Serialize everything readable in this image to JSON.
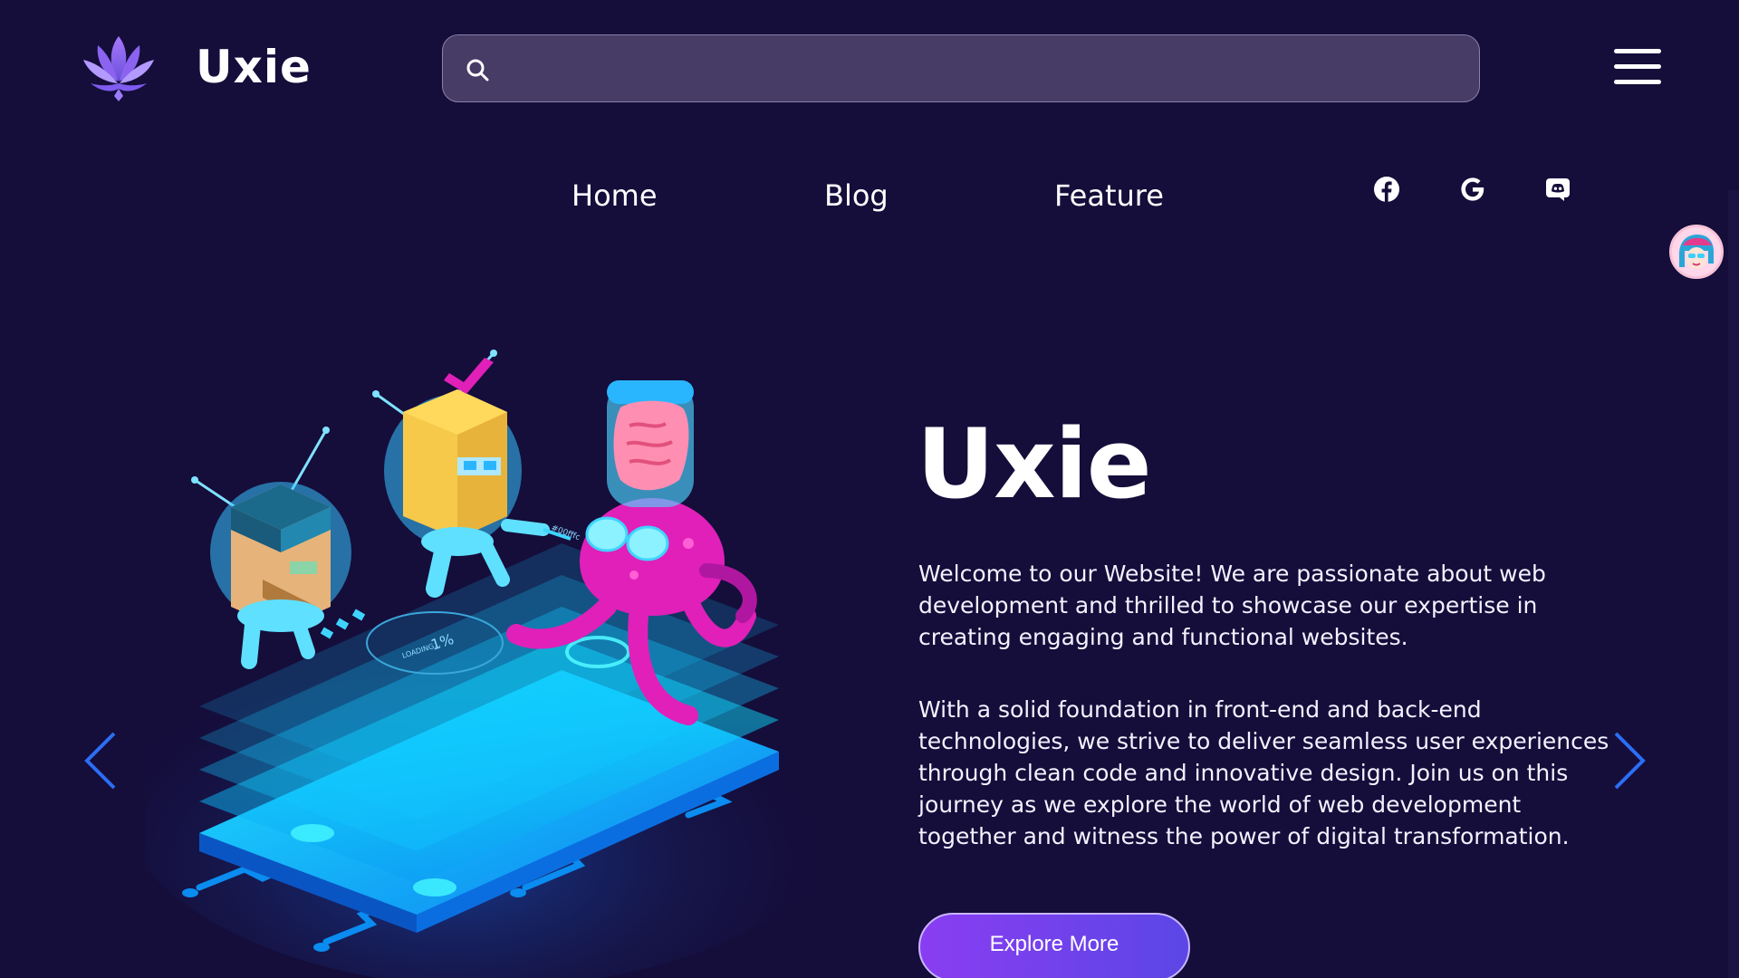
{
  "header": {
    "brand": "Uxie",
    "search": {
      "placeholder": "",
      "value": ""
    }
  },
  "nav": {
    "items": [
      "Home",
      "Blog",
      "Feature"
    ],
    "social": [
      "facebook-icon",
      "google-icon",
      "discord-icon"
    ]
  },
  "hero": {
    "title": "Uxie",
    "paragraph_1": "Welcome to our Website! We are passionate about web development and thrilled to showcase our expertise in creating engaging and functional websites.",
    "paragraph_2": "With a solid foundation in front-end and back-end technologies, we strive to deliver seamless user experiences through clean code and innovative design. Join us on this journey as we explore the world of web development together and witness the power of digital transformation.",
    "cta_label": "Explore More"
  },
  "illustration": {
    "loading_text": "LOADING...",
    "percent_text": "1%",
    "tag_text": "#00fffc"
  },
  "colors": {
    "background": "#150d3a",
    "search_bg": "#463c66",
    "accent_purple": "#8a3df2",
    "accent_blue": "#2b6ef5",
    "cyan": "#00d8ff",
    "magenta": "#e020b8"
  }
}
